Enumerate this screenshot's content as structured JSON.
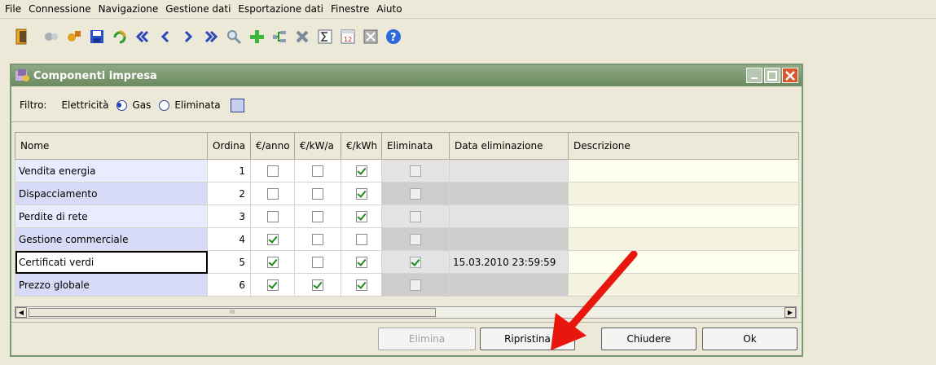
{
  "menu": [
    "File",
    "Connessione",
    "Navigazione",
    "Gestione dati",
    "Esportazione dati",
    "Finestre",
    "Aiuto"
  ],
  "toolbar_icons": [
    "exit-icon",
    "connect-icon",
    "disconnect-icon",
    "save-icon",
    "refresh-icon",
    "first-icon",
    "previous-icon",
    "next-icon",
    "last-icon",
    "search-icon",
    "add-icon",
    "structure-icon",
    "delete-icon",
    "sum-icon",
    "calendar-icon",
    "export-icon",
    "help-icon"
  ],
  "window": {
    "title": "Componenti impresa"
  },
  "filter": {
    "label": "Filtro:",
    "options": [
      {
        "label": "Elettricità",
        "selected": true
      },
      {
        "label": "Gas",
        "selected": false
      }
    ],
    "eliminated_label": "Eliminata",
    "eliminated_checked": false
  },
  "table": {
    "columns": [
      "Nome",
      "Ordina",
      "€/anno",
      "€/kW/a",
      "€/kWh",
      "Eliminata",
      "Data eliminazione",
      "Descrizione"
    ],
    "rows": [
      {
        "nome": "Vendita energia",
        "ordina": "1",
        "anno": false,
        "kwa": false,
        "kwh": true,
        "elim": false,
        "data": "",
        "desc": ""
      },
      {
        "nome": "Dispacciamento",
        "ordina": "2",
        "anno": false,
        "kwa": false,
        "kwh": true,
        "elim": false,
        "data": "",
        "desc": ""
      },
      {
        "nome": "Perdite di rete",
        "ordina": "3",
        "anno": false,
        "kwa": false,
        "kwh": true,
        "elim": false,
        "data": "",
        "desc": ""
      },
      {
        "nome": "Gestione commerciale",
        "ordina": "4",
        "anno": true,
        "kwa": false,
        "kwh": false,
        "elim": false,
        "data": "",
        "desc": ""
      },
      {
        "nome": "Certificati verdi",
        "ordina": "5",
        "anno": true,
        "kwa": false,
        "kwh": true,
        "elim": true,
        "data": "15.03.2010 23:59:59",
        "desc": ""
      },
      {
        "nome": "Prezzo globale",
        "ordina": "6",
        "anno": true,
        "kwa": true,
        "kwh": true,
        "elim": false,
        "data": "",
        "desc": ""
      }
    ]
  },
  "buttons": {
    "elimina": "Elimina",
    "ripristina": "Ripristina",
    "chiudere": "Chiudere",
    "ok": "Ok"
  },
  "colors": {
    "titlebar": "#7a9873",
    "arrow": "#e8160c",
    "check": "#1c8a1c"
  }
}
